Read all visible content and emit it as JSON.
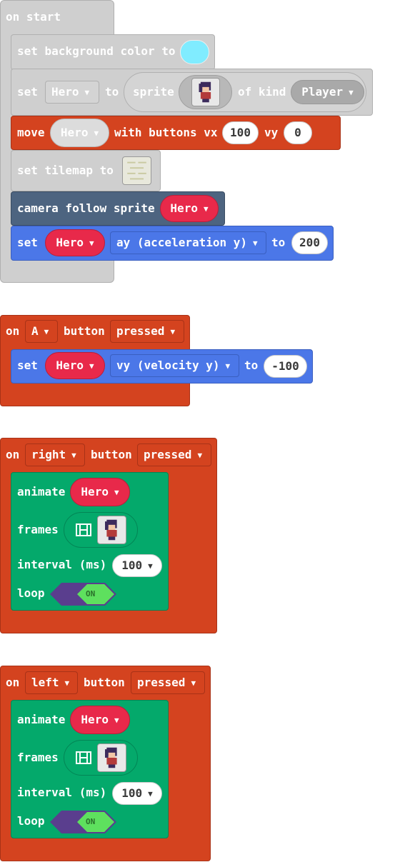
{
  "start_block": {
    "hat": "on start",
    "bg_label": "set background color to",
    "bg_color": "#80ecff",
    "set_label": "set",
    "set_var": "Hero",
    "to_label": "to",
    "sprite_label": "sprite",
    "of_kind_label": "of kind",
    "kind": "Player",
    "move_label": "move",
    "move_var": "Hero",
    "with_buttons": "with buttons vx",
    "vx": "100",
    "vy_label": "vy",
    "vy": "0",
    "tilemap_label": "set tilemap to",
    "camera_label": "camera follow sprite",
    "camera_var": "Hero",
    "set2_label": "set",
    "set2_var": "Hero",
    "set2_prop": "ay (acceleration y)",
    "set2_to": "to",
    "set2_value": "200"
  },
  "a_block": {
    "on": "on",
    "button": "A",
    "button_label": "button",
    "event": "pressed",
    "set_label": "set",
    "var": "Hero",
    "prop": "vy (velocity y)",
    "to": "to",
    "value": "-100"
  },
  "right_block": {
    "on": "on",
    "button": "right",
    "button_label": "button",
    "event": "pressed",
    "animate_label": "animate",
    "var": "Hero",
    "frames_label": "frames",
    "interval_label": "interval (ms)",
    "interval": "100",
    "loop_label": "loop",
    "loop_value": "ON"
  },
  "left_block": {
    "on": "on",
    "button": "left",
    "button_label": "button",
    "event": "pressed",
    "animate_label": "animate",
    "var": "Hero",
    "frames_label": "frames",
    "interval_label": "interval (ms)",
    "interval": "100",
    "loop_label": "loop",
    "loop_value": "ON"
  },
  "icons": [
    "chevron-down-icon",
    "hero-sprite-icon",
    "tilemap-icon",
    "film-icon"
  ]
}
